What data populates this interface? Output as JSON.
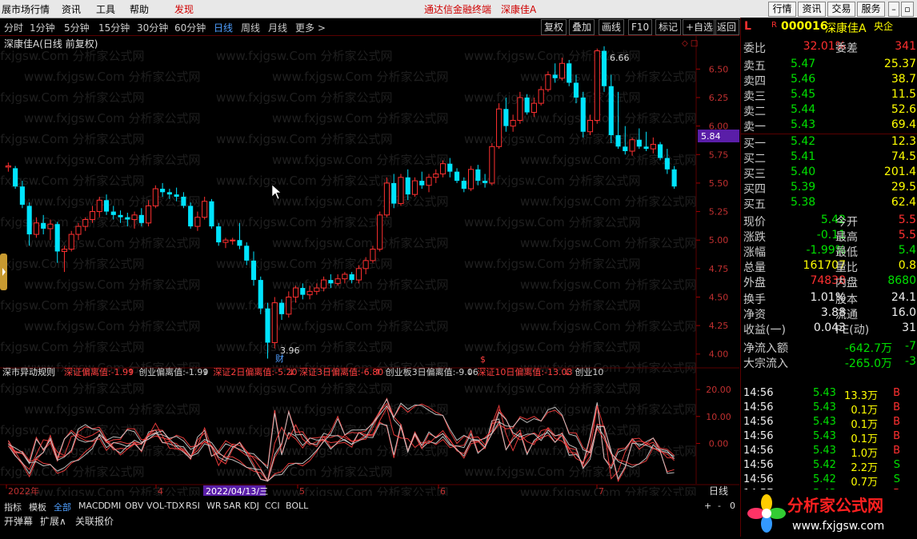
{
  "menu": {
    "items": [
      "展市场行情",
      "资讯",
      "工具",
      "帮助",
      "发现"
    ],
    "center_title": "通达信金融终端",
    "center_stock": "深康佳A",
    "right_buttons": [
      "行情",
      "资讯",
      "交易",
      "服务"
    ]
  },
  "toolbar": {
    "periods": [
      "分时",
      "1分钟",
      "5分钟",
      "15分钟",
      "30分钟",
      "60分钟",
      "日线",
      "周线",
      "月线",
      "更多 >"
    ],
    "selected": "日线",
    "buttons": [
      "复权",
      "叠加",
      "画线",
      "F10",
      "标记",
      "+自选",
      "返回"
    ]
  },
  "chart_title": "深康佳A(日线 前复权)",
  "watermark": "www.fxjgsw.Com 分析家公式网",
  "chart_data": [
    {
      "type": "candlestick",
      "title": "深康佳A(日线 前复权)",
      "y_ticks": [
        4.0,
        4.25,
        4.5,
        4.75,
        5.0,
        5.25,
        5.5,
        5.75,
        6.0,
        6.25,
        6.5
      ],
      "ylim": [
        3.9,
        6.72
      ],
      "x_ticks": [
        "2022年",
        "4",
        "5",
        "6",
        "7"
      ],
      "cursor_date": "2022/04/13/三",
      "current_price_label": "5.84",
      "annotations": [
        {
          "text": "6.66",
          "type": "high"
        },
        {
          "text": "3.96",
          "type": "low"
        }
      ],
      "markers": [
        "财",
        "$"
      ],
      "ohlc": [
        [
          5.64,
          5.68,
          5.6,
          5.65
        ],
        [
          5.63,
          5.65,
          5.45,
          5.47
        ],
        [
          5.47,
          5.52,
          5.28,
          5.31
        ],
        [
          5.3,
          5.33,
          4.95,
          5.05
        ],
        [
          5.05,
          5.2,
          5.02,
          5.15
        ],
        [
          5.15,
          5.22,
          5.05,
          5.1
        ],
        [
          5.1,
          5.18,
          5.0,
          5.14
        ],
        [
          5.14,
          5.16,
          4.8,
          4.9
        ],
        [
          4.9,
          4.95,
          4.72,
          4.92
        ],
        [
          4.92,
          5.08,
          4.9,
          5.05
        ],
        [
          5.05,
          5.15,
          5.0,
          5.12
        ],
        [
          5.12,
          5.2,
          5.08,
          5.18
        ],
        [
          5.18,
          5.3,
          5.15,
          5.25
        ],
        [
          5.25,
          5.38,
          5.2,
          5.35
        ],
        [
          5.35,
          5.4,
          5.22,
          5.25
        ],
        [
          5.25,
          5.3,
          5.18,
          5.22
        ],
        [
          5.22,
          5.26,
          5.15,
          5.2
        ],
        [
          5.2,
          5.24,
          5.12,
          5.18
        ],
        [
          5.18,
          5.25,
          5.1,
          5.22
        ],
        [
          5.22,
          5.28,
          5.12,
          5.15
        ],
        [
          5.15,
          5.35,
          5.12,
          5.3
        ],
        [
          5.3,
          5.48,
          5.28,
          5.45
        ],
        [
          5.45,
          5.5,
          5.38,
          5.42
        ],
        [
          5.42,
          5.45,
          5.36,
          5.4
        ],
        [
          5.4,
          5.46,
          5.34,
          5.38
        ],
        [
          5.38,
          5.42,
          5.28,
          5.3
        ],
        [
          5.3,
          5.33,
          5.1,
          5.12
        ],
        [
          5.12,
          5.25,
          5.08,
          5.2
        ],
        [
          5.2,
          5.38,
          5.18,
          5.34
        ],
        [
          5.34,
          5.36,
          5.1,
          5.12
        ],
        [
          5.12,
          5.15,
          4.95,
          4.98
        ],
        [
          4.98,
          5.02,
          4.93,
          5.0
        ],
        [
          5.0,
          5.02,
          4.96,
          5.0
        ],
        [
          5.0,
          5.15,
          4.92,
          4.95
        ],
        [
          4.95,
          4.98,
          4.78,
          4.82
        ],
        [
          4.82,
          4.9,
          4.6,
          4.65
        ],
        [
          4.65,
          4.68,
          4.35,
          4.4
        ],
        [
          4.4,
          4.45,
          3.96,
          4.1
        ],
        [
          4.1,
          4.5,
          4.05,
          4.45
        ],
        [
          4.45,
          4.48,
          4.3,
          4.35
        ],
        [
          4.35,
          4.55,
          4.32,
          4.5
        ],
        [
          4.5,
          4.6,
          4.45,
          4.58
        ],
        [
          4.58,
          4.62,
          4.48,
          4.52
        ],
        [
          4.52,
          4.6,
          4.48,
          4.55
        ],
        [
          4.55,
          4.62,
          4.52,
          4.58
        ],
        [
          4.58,
          4.68,
          4.55,
          4.65
        ],
        [
          4.65,
          4.7,
          4.58,
          4.62
        ],
        [
          4.62,
          4.7,
          4.6,
          4.66
        ],
        [
          4.66,
          4.72,
          4.62,
          4.7
        ],
        [
          4.7,
          4.72,
          4.62,
          4.65
        ],
        [
          4.65,
          4.78,
          4.62,
          4.75
        ],
        [
          4.75,
          4.85,
          4.7,
          4.82
        ],
        [
          4.82,
          4.95,
          4.8,
          4.92
        ],
        [
          4.92,
          5.25,
          4.9,
          5.22
        ],
        [
          5.22,
          5.55,
          5.2,
          5.5
        ],
        [
          5.5,
          5.58,
          5.28,
          5.32
        ],
        [
          5.32,
          5.58,
          5.3,
          5.55
        ],
        [
          5.55,
          5.62,
          5.35,
          5.4
        ],
        [
          5.4,
          5.55,
          5.38,
          5.52
        ],
        [
          5.52,
          5.6,
          5.45,
          5.48
        ],
        [
          5.48,
          5.58,
          5.42,
          5.55
        ],
        [
          5.55,
          5.62,
          5.5,
          5.58
        ],
        [
          5.58,
          5.7,
          5.55,
          5.67
        ],
        [
          5.67,
          5.72,
          5.55,
          5.6
        ],
        [
          5.6,
          5.63,
          5.5,
          5.52
        ],
        [
          5.52,
          5.55,
          5.42,
          5.45
        ],
        [
          5.45,
          5.65,
          5.43,
          5.62
        ],
        [
          5.62,
          5.66,
          5.48,
          5.52
        ],
        [
          5.52,
          5.58,
          5.46,
          5.5
        ],
        [
          5.5,
          5.85,
          5.48,
          5.82
        ],
        [
          5.82,
          6.2,
          5.8,
          6.15
        ],
        [
          6.15,
          6.25,
          5.95,
          6.0
        ],
        [
          6.0,
          6.1,
          5.95,
          6.05
        ],
        [
          6.05,
          6.3,
          6.02,
          6.25
        ],
        [
          6.25,
          6.28,
          6.1,
          6.12
        ],
        [
          6.12,
          6.25,
          6.08,
          6.2
        ],
        [
          6.2,
          6.35,
          6.18,
          6.32
        ],
        [
          6.32,
          6.48,
          6.3,
          6.45
        ],
        [
          6.45,
          6.55,
          6.38,
          6.42
        ],
        [
          6.42,
          6.6,
          6.4,
          6.55
        ],
        [
          6.55,
          6.58,
          6.35,
          6.38
        ],
        [
          6.38,
          6.45,
          6.2,
          6.25
        ],
        [
          6.25,
          6.3,
          5.9,
          5.95
        ],
        [
          5.95,
          6.1,
          5.92,
          6.05
        ],
        [
          6.05,
          6.68,
          6.02,
          6.66
        ],
        [
          6.66,
          6.7,
          6.3,
          6.35
        ],
        [
          6.35,
          6.45,
          5.85,
          5.92
        ],
        [
          5.92,
          6.3,
          5.8,
          5.82
        ],
        [
          5.82,
          6.0,
          5.75,
          5.78
        ],
        [
          5.78,
          5.9,
          5.74,
          5.88
        ],
        [
          5.88,
          5.98,
          5.8,
          5.82
        ],
        [
          5.82,
          5.95,
          5.78,
          5.8
        ],
        [
          5.8,
          5.9,
          5.76,
          5.84
        ],
        [
          5.84,
          5.86,
          5.7,
          5.72
        ],
        [
          5.72,
          5.8,
          5.58,
          5.62
        ],
        [
          5.62,
          5.65,
          5.45,
          5.47
        ]
      ]
    },
    {
      "type": "line",
      "title": "深市异动规则",
      "series": [
        {
          "name": "深证偏离值",
          "label_value": "-1.99",
          "color": "#ff4040"
        },
        {
          "name": "创业偏离值",
          "label_value": "-1.99",
          "color": "#d0d0d0"
        },
        {
          "name": "深证2日偏离值",
          "label_value": "-5.20",
          "color": "#ff4040"
        },
        {
          "name": "深证3日偏离值",
          "label_value": "-6.80",
          "color": "#ff4040"
        },
        {
          "name": "创业板3日偏离值",
          "label_value": "-9.06",
          "color": "#d0d0d0"
        },
        {
          "name": "深证10日偏离值",
          "label_value": "-13.03",
          "color": "#ff4040"
        },
        {
          "name": "创业10",
          "label_value": "",
          "color": "#d0d0d0"
        }
      ],
      "y_ticks": [
        0.0,
        10.0,
        20.0
      ],
      "ylim": [
        -15,
        23
      ]
    }
  ],
  "bottom_tabs": [
    "指标",
    "模板",
    "全部",
    "MACD",
    "DMI",
    "OBV",
    "VOL-TDX",
    "RSI",
    "WR",
    "SAR",
    "KDJ",
    "CCI",
    "BOLL"
  ],
  "bottom_selected": "全部",
  "bottom_right": [
    "+",
    "-",
    "0"
  ],
  "bottom2": [
    "开弹幕",
    "扩展∧",
    "关联报价"
  ],
  "period_label": "日线",
  "quote": {
    "code": "000016",
    "name": "深康佳A",
    "tag": "央企",
    "r_mark": "R",
    "l_mark": "L",
    "weibi_label": "委比",
    "weibi": "32.01%",
    "weicha_label": "委差",
    "weicha": "341",
    "sells": [
      {
        "label": "卖五",
        "price": "5.47",
        "vol": "25.37"
      },
      {
        "label": "卖四",
        "price": "5.46",
        "vol": "38.7"
      },
      {
        "label": "卖三",
        "price": "5.45",
        "vol": "11.5"
      },
      {
        "label": "卖二",
        "price": "5.44",
        "vol": "52.6"
      },
      {
        "label": "卖一",
        "price": "5.43",
        "vol": "69.4"
      }
    ],
    "buys": [
      {
        "label": "买一",
        "price": "5.42",
        "vol": "12.3"
      },
      {
        "label": "买二",
        "price": "5.41",
        "vol": "74.5"
      },
      {
        "label": "买三",
        "price": "5.40",
        "vol": "201.4"
      },
      {
        "label": "买四",
        "price": "5.39",
        "vol": "29.5"
      },
      {
        "label": "买五",
        "price": "5.38",
        "vol": "62.4"
      }
    ],
    "stats": [
      {
        "l1": "现价",
        "v1": "5.42",
        "c1": "g",
        "l2": "今开",
        "v2": "5.5",
        "c2": "r"
      },
      {
        "l1": "涨跌",
        "v1": "-0.11",
        "c1": "g",
        "l2": "最高",
        "v2": "5.5",
        "c2": "r"
      },
      {
        "l1": "涨幅",
        "v1": "-1.99%",
        "c1": "g",
        "l2": "最低",
        "v2": "5.4",
        "c2": "g"
      },
      {
        "l1": "总量",
        "v1": "161707",
        "c1": "y",
        "l2": "量比",
        "v2": "0.8",
        "c2": "y"
      },
      {
        "l1": "外盘",
        "v1": "74838",
        "c1": "r",
        "l2": "内盘",
        "v2": "8680",
        "c2": "g"
      }
    ],
    "stats2": [
      {
        "l1": "换手",
        "v1": "1.01%",
        "c1": "w",
        "l2": "股本",
        "v2": "24.1",
        "c2": "w"
      },
      {
        "l1": "净资",
        "v1": "3.88",
        "c1": "w",
        "l2": "流通",
        "v2": "16.0",
        "c2": "w"
      },
      {
        "l1": "收益(一)",
        "v1": "0.043",
        "c1": "w",
        "l2": "PE(动)",
        "v2": "31",
        "c2": "w"
      }
    ],
    "flows": [
      {
        "label": "净流入额",
        "v1": "-642.7万",
        "v2": "-7"
      },
      {
        "label": "大宗流入",
        "v1": "-265.0万",
        "v2": "-3"
      }
    ],
    "ticks": [
      {
        "t": "14:56",
        "p": "5.43",
        "v": "13.3万",
        "bs": "B"
      },
      {
        "t": "14:56",
        "p": "5.43",
        "v": "0.1万",
        "bs": "B"
      },
      {
        "t": "14:56",
        "p": "5.43",
        "v": "0.1万",
        "bs": "B"
      },
      {
        "t": "14:56",
        "p": "5.43",
        "v": "0.1万",
        "bs": "B"
      },
      {
        "t": "14:56",
        "p": "5.43",
        "v": "1.0万",
        "bs": "B"
      },
      {
        "t": "14:56",
        "p": "5.42",
        "v": "2.2万",
        "bs": "S"
      },
      {
        "t": "14:56",
        "p": "5.42",
        "v": "0.7万",
        "bs": "S"
      },
      {
        "t": "14:57",
        "p": "5.43",
        "v": "0.1万",
        "bs": "B"
      }
    ]
  },
  "logo": {
    "text": "分析家公式网",
    "url": "www.fxjgsw.com"
  },
  "colors": {
    "up": "#ff3030",
    "down": "#00e4ff",
    "grid": "#5a0000",
    "accent": "#d00000"
  }
}
